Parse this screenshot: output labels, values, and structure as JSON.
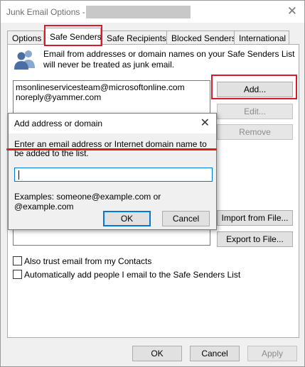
{
  "window": {
    "title": "Junk Email Options -",
    "close_glyph": "✕"
  },
  "tabs": [
    {
      "label": "Options"
    },
    {
      "label": "Safe Senders"
    },
    {
      "label": "Safe Recipients"
    },
    {
      "label": "Blocked Senders"
    },
    {
      "label": "International"
    }
  ],
  "safe_senders": {
    "description": "Email from addresses or domain names on your Safe Senders List will never be treated as junk email.",
    "list": [
      "msonlineservicesteam@microsoftonline.com",
      "noreply@yammer.com"
    ],
    "add_label": "Add...",
    "edit_label": "Edit...",
    "remove_label": "Remove",
    "import_label": "Import from File...",
    "export_label": "Export to File...",
    "trust_contacts_label": "Also trust email from my Contacts",
    "auto_add_label": "Automatically add people I email to the Safe Senders List",
    "trust_contacts_checked": false,
    "auto_add_checked": false
  },
  "footer": {
    "ok_label": "OK",
    "cancel_label": "Cancel",
    "apply_label": "Apply"
  },
  "dialog": {
    "title": "Add address or domain",
    "close_glyph": "✕",
    "prompt": "Enter an email address or Internet domain name to be added to the list.",
    "input_value": "",
    "examples": "Examples: someone@example.com or @example.com",
    "ok_label": "OK",
    "cancel_label": "Cancel"
  },
  "colors": {
    "highlight": "#d81b2b",
    "focus_blue": "#0078d7",
    "people_icon_blue": "#4a6fa5"
  }
}
